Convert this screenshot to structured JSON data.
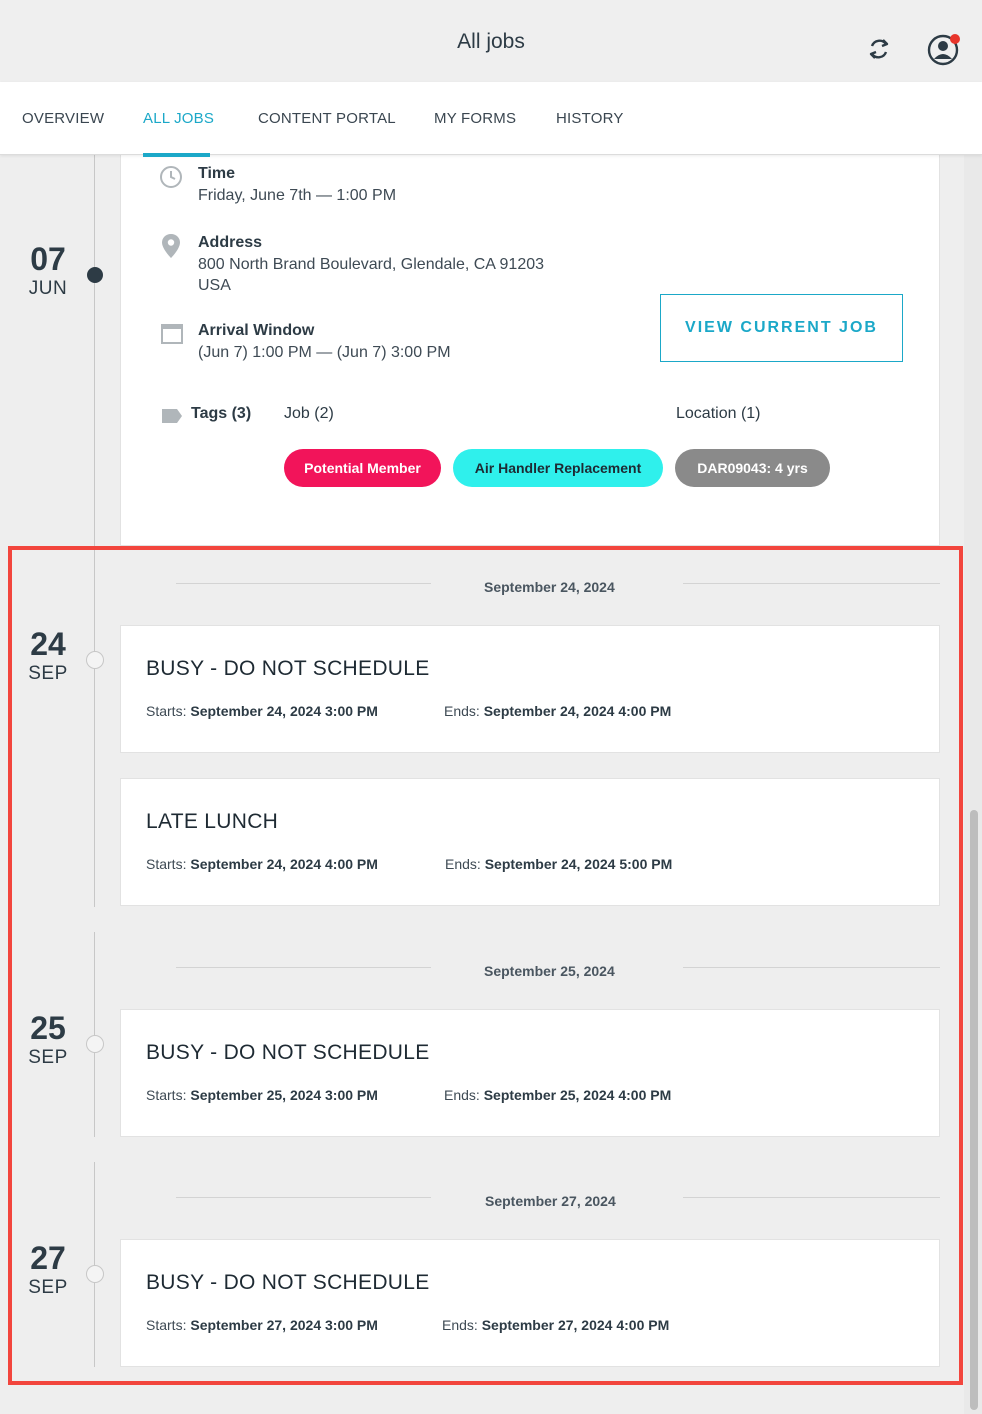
{
  "header": {
    "title": "All jobs"
  },
  "tabs": [
    {
      "label": "OVERVIEW"
    },
    {
      "label": "ALL JOBS",
      "active": true
    },
    {
      "label": "CONTENT PORTAL"
    },
    {
      "label": "MY FORMS"
    },
    {
      "label": "HISTORY"
    }
  ],
  "colors": {
    "accent": "#1ba8c8",
    "highlight": "#f2453d",
    "tag_red": "#f2145a",
    "tag_cyan": "#2ff0ec",
    "tag_gray": "#8a8a8a"
  },
  "current_job": {
    "day": "07",
    "month": "JUN",
    "time_label": "Time",
    "time_value": "Friday, June 7th — 1:00 PM",
    "address_label": "Address",
    "address_line1": "800 North Brand Boulevard, Glendale, CA 91203",
    "address_line2": "USA",
    "arrival_label": "Arrival Window",
    "arrival_value": "(Jun 7) 1:00 PM — (Jun 7) 3:00 PM",
    "view_button": "VIEW CURRENT JOB",
    "tags_label": "Tags (3)",
    "job_tags_label": "Job (2)",
    "location_tags_label": "Location (1)",
    "tags": [
      {
        "text": "Potential Member"
      },
      {
        "text": "Air Handler Replacement"
      },
      {
        "text": "DAR09043: 4 yrs"
      }
    ]
  },
  "groups": [
    {
      "separator": "September 24, 2024",
      "day": "24",
      "month": "SEP",
      "events": [
        {
          "title": "BUSY - DO NOT SCHEDULE",
          "starts_label": "Starts:",
          "starts": "September 24, 2024 3:00 PM",
          "ends_label": "Ends:",
          "ends": "September 24, 2024 4:00 PM"
        },
        {
          "title": "LATE LUNCH",
          "starts_label": "Starts:",
          "starts": "September 24, 2024 4:00 PM",
          "ends_label": "Ends:",
          "ends": "September 24, 2024 5:00 PM"
        }
      ]
    },
    {
      "separator": "September 25, 2024",
      "day": "25",
      "month": "SEP",
      "events": [
        {
          "title": "BUSY - DO NOT SCHEDULE",
          "starts_label": "Starts:",
          "starts": "September 25, 2024 3:00 PM",
          "ends_label": "Ends:",
          "ends": "September 25, 2024 4:00 PM"
        }
      ]
    },
    {
      "separator": "September 27, 2024",
      "day": "27",
      "month": "SEP",
      "events": [
        {
          "title": "BUSY - DO NOT SCHEDULE",
          "starts_label": "Starts:",
          "starts": "September 27, 2024 3:00 PM",
          "ends_label": "Ends:",
          "ends": "September 27, 2024 4:00 PM"
        }
      ]
    }
  ],
  "icons": [
    "sync-icon",
    "profile-icon",
    "clock-icon",
    "map-pin-icon",
    "calendar-icon",
    "tag-icon"
  ]
}
